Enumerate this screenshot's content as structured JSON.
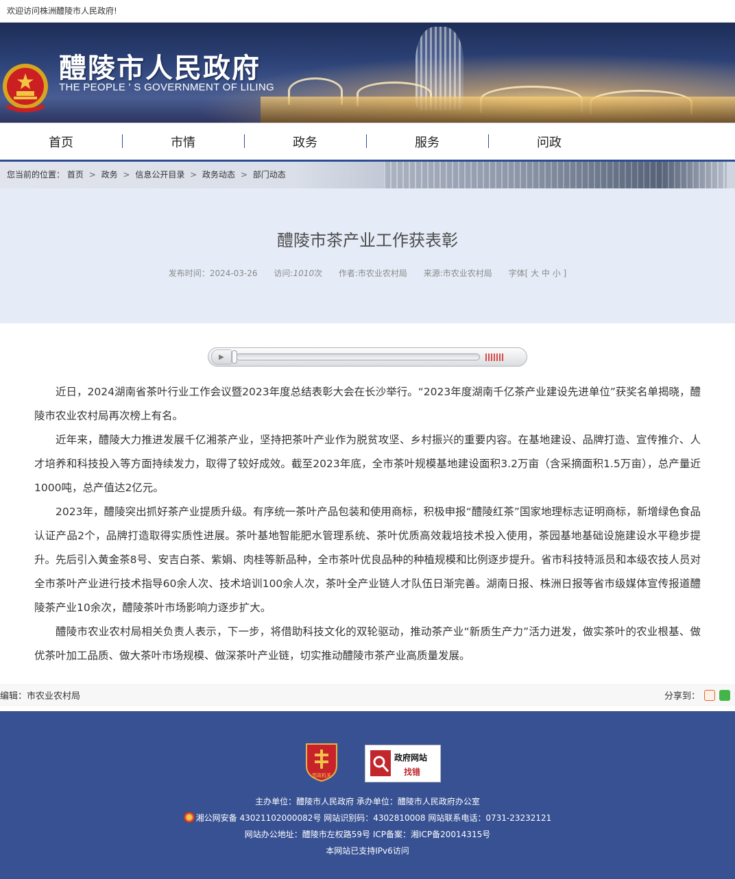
{
  "topbar": {
    "welcome": "欢迎访问株洲醴陵市人民政府!"
  },
  "header": {
    "site_name": "醴陵市人民政府",
    "site_name_en": "THE PEOPLE ' S GOVERNMENT OF LILING"
  },
  "nav": {
    "items": [
      "首页",
      "市情",
      "政务",
      "服务",
      "问政"
    ]
  },
  "breadcrumb": {
    "prefix": "您当前的位置：",
    "items": [
      "首页",
      "政务",
      "信息公开目录",
      "政务动态",
      "部门动态"
    ],
    "separator": ">"
  },
  "article": {
    "title": "醴陵市茶产业工作获表彰",
    "publish_label": "发布时间：",
    "publish_date": "2024-03-26",
    "visits_label": "访问:",
    "visits_value": "1010",
    "visits_unit": "次",
    "author": "作者:市农业农村局",
    "source": "来源:市农业农村局",
    "font_size": "字体[ 大 中 小 ]",
    "paragraphs": [
      "近日，2024湖南省茶叶行业工作会议暨2023年度总结表彰大会在长沙举行。“2023年度湖南千亿茶产业建设先进单位”获奖名单揭晓，醴陵市农业农村局再次榜上有名。",
      "近年来，醴陵大力推进发展千亿湘茶产业，坚持把茶叶产业作为脱贫攻坚、乡村振兴的重要内容。在基地建设、品牌打造、宣传推介、人才培养和科技投入等方面持续发力，取得了较好成效。截至2023年底，全市茶叶规模基地建设面积3.2万亩（含采摘面积1.5万亩），总产量近1000吨，总产值达2亿元。",
      "2023年，醴陵突出抓好茶产业提质升级。有序统一茶叶产品包装和使用商标，积极申报“醴陵红茶”国家地理标志证明商标，新增绿色食品认证产品2个，品牌打造取得实质性进展。茶叶基地智能肥水管理系统、茶叶优质高效栽培技术投入使用，茶园基地基础设施建设水平稳步提升。先后引入黄金茶8号、安吉白茶、紫娟、肉桂等新品种，全市茶叶优良品种的种植规模和比例逐步提升。省市科技特派员和本级农技人员对全市茶叶产业进行技术指导60余人次、技术培训100余人次，茶叶全产业链人才队伍日渐完善。湖南日报、株洲日报等省市级媒体宣传报道醴陵茶产业10余次，醴陵茶叶市场影响力逐步扩大。",
      "醴陵市农业农村局相关负责人表示，下一步，将借助科技文化的双轮驱动，推动茶产业“新质生产力”活力迸发，做实茶叶的农业根基、做优茶叶加工品质、做大茶叶市场规模、做深茶叶产业链，切实推动醴陵市茶产业高质量发展。"
    ],
    "editor": "编辑：市农业农村局",
    "share_label": "分享到："
  },
  "player": {
    "play_icon": "play-icon"
  },
  "footer": {
    "party_badge_text": "党政机关",
    "find_mistake_line1": "政府网站",
    "find_mistake_line2": "找错",
    "line1": "主办单位：醴陵市人民政府 承办单位：醴陵市人民政府办公室",
    "line2": "湘公网安备 43021102000082号 网站识别码：4302810008 网站联系电话：0731-23232121",
    "line3": "网站办公地址：醴陵市左权路59号   ICP备案：湘ICP备20014315号",
    "line4": "本网站已支持IPv6访问"
  },
  "colors": {
    "nav_accent": "#2b4c92",
    "footer_bg": "#375193",
    "title_bg": "#e6ecf7"
  }
}
